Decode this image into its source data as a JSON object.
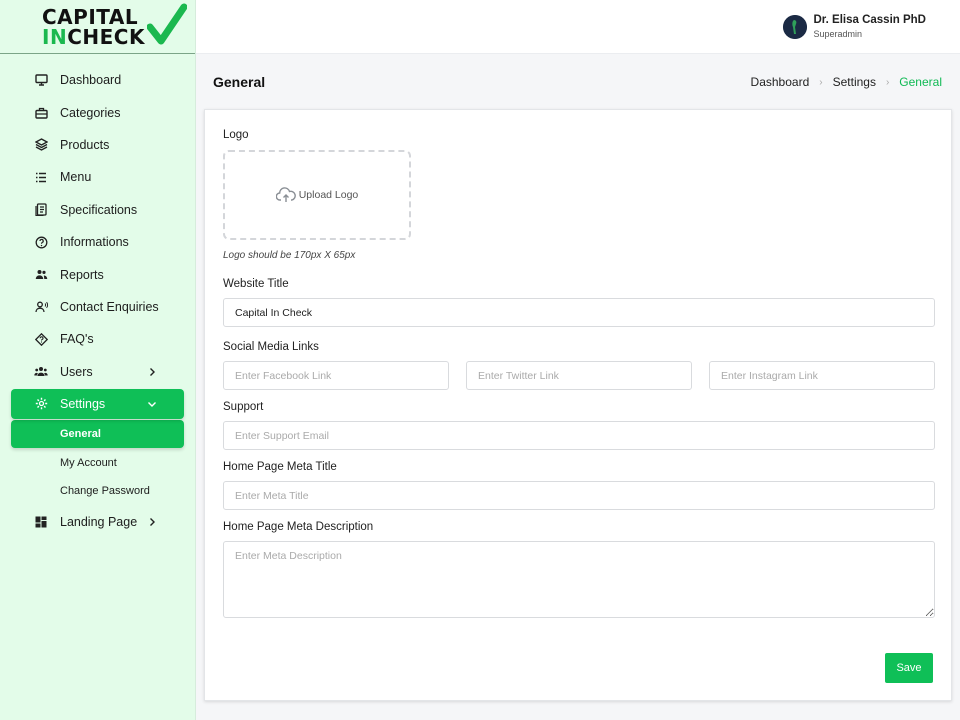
{
  "logo": {
    "line1": "CAPITAL",
    "line2_a": "IN",
    "line2_b": "CHECK"
  },
  "user": {
    "name": "Dr. Elisa Cassin PhD",
    "role": "Superadmin"
  },
  "sidebar": {
    "items": [
      {
        "label": "Dashboard",
        "icon": "monitor-icon"
      },
      {
        "label": "Categories",
        "icon": "briefcase-icon"
      },
      {
        "label": "Products",
        "icon": "layers-icon"
      },
      {
        "label": "Menu",
        "icon": "list-icon"
      },
      {
        "label": "Specifications",
        "icon": "document-icon"
      },
      {
        "label": "Informations",
        "icon": "info-icon"
      },
      {
        "label": "Reports",
        "icon": "people-icon"
      },
      {
        "label": "Contact Enquiries",
        "icon": "user-voice-icon"
      },
      {
        "label": "FAQ's",
        "icon": "faq-icon"
      },
      {
        "label": "Users",
        "icon": "users-icon"
      },
      {
        "label": "Settings",
        "icon": "settings-icon"
      },
      {
        "label": "Landing Page",
        "icon": "dashboard-grid-icon"
      }
    ],
    "settings_sub": [
      "General",
      "My Account",
      "Change Password"
    ]
  },
  "page": {
    "title": "General"
  },
  "breadcrumb": [
    "Dashboard",
    "Settings",
    "General"
  ],
  "form": {
    "logo_label": "Logo",
    "upload_label": "Upload Logo",
    "logo_hint": "Logo should be 170px X 65px",
    "website_title_label": "Website Title",
    "website_title_value": "Capital In Check",
    "social_label": "Social Media Links",
    "facebook_placeholder": "Enter Facebook Link",
    "twitter_placeholder": "Enter Twitter Link",
    "instagram_placeholder": "Enter Instagram Link",
    "support_label": "Support",
    "support_placeholder": "Enter Support Email",
    "meta_title_label": "Home Page Meta Title",
    "meta_title_placeholder": "Enter Meta Title",
    "meta_desc_label": "Home Page Meta Description",
    "meta_desc_placeholder": "Enter Meta Description",
    "save_label": "Save"
  },
  "colors": {
    "accent": "#0fbf57",
    "sidebar_bg": "#e3fce9"
  }
}
